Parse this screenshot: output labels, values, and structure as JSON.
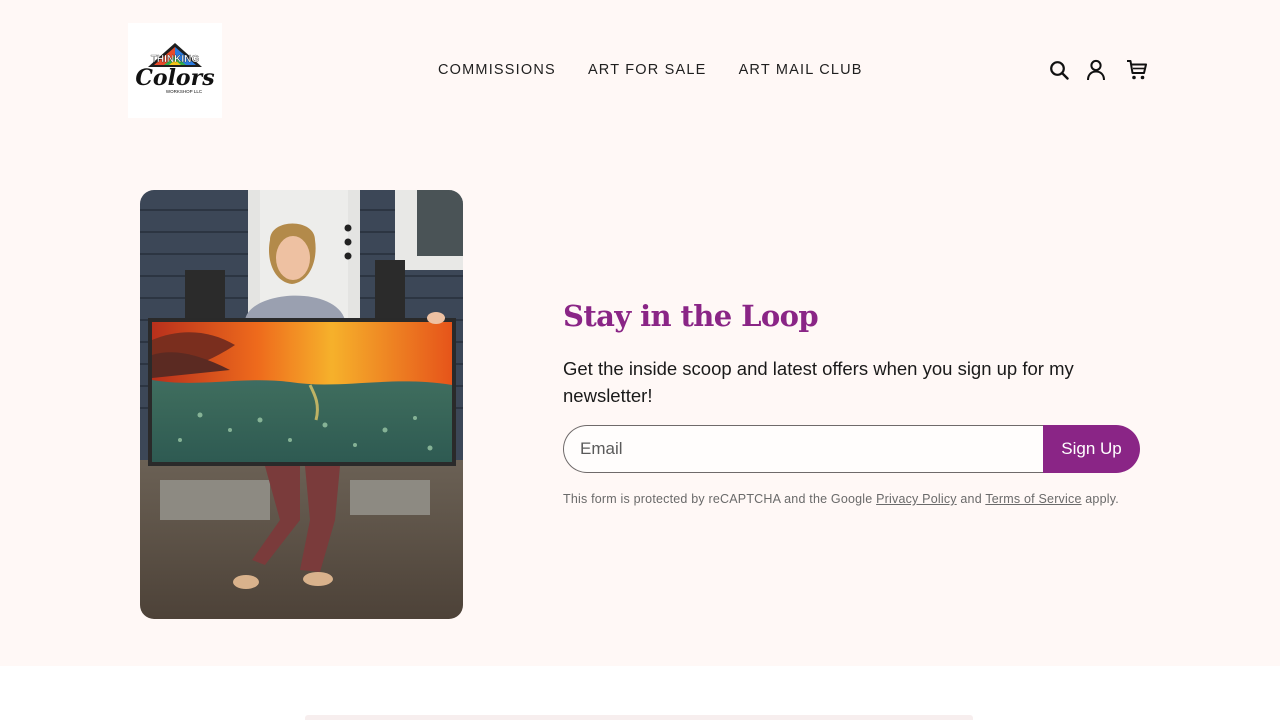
{
  "header": {
    "logo": {
      "line1": "THINKING",
      "line2": "Colors",
      "line3": "WORKSHOP LLC"
    },
    "nav": [
      {
        "label": "COMMISSIONS"
      },
      {
        "label": "ART FOR SALE"
      },
      {
        "label": "ART MAIL CLUB"
      }
    ],
    "icons": [
      "search-icon",
      "account-icon",
      "cart-icon"
    ]
  },
  "hero": {
    "image": "photo of artist holding a large sunset-over-water painting"
  },
  "newsletter": {
    "title": "Stay in the Loop",
    "lede": "Get the inside scoop and latest offers when you sign up for my newsletter!",
    "email_placeholder": "Email",
    "button_label": "Sign Up",
    "recaptcha_prefix": "This form is protected by reCAPTCHA and the Google ",
    "privacy_label": "Privacy Policy",
    "recaptcha_and": " and ",
    "terms_label": "Terms of Service",
    "recaptcha_suffix": " apply."
  },
  "colors": {
    "accent": "#8a2586",
    "background": "#fff8f6"
  }
}
